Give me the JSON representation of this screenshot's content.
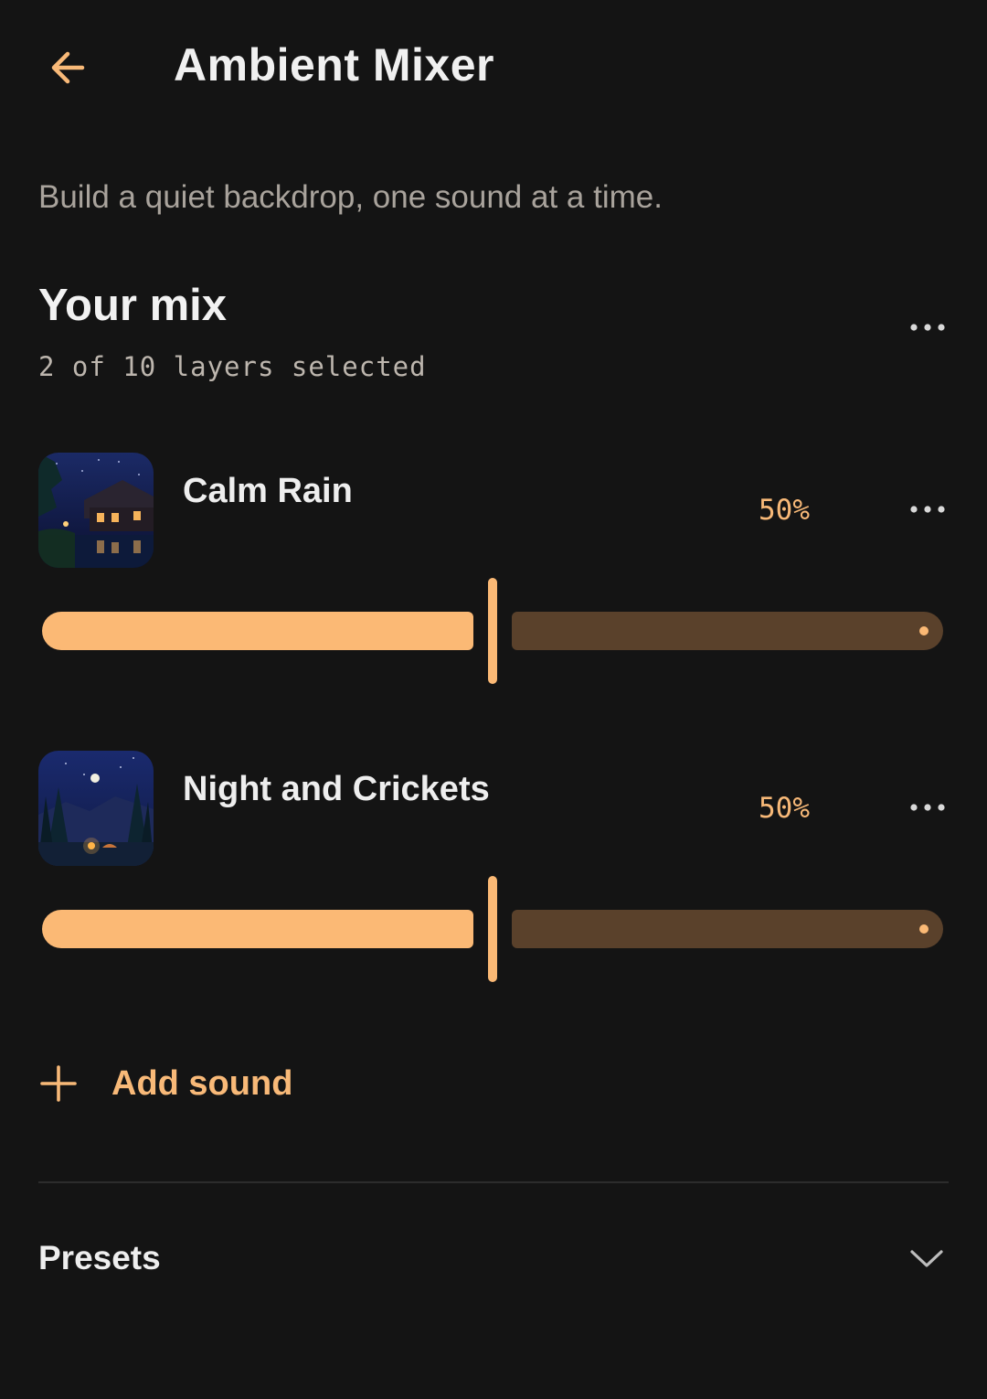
{
  "header": {
    "title": "Ambient Mixer",
    "back_icon": "arrow-left-icon"
  },
  "subtitle": "Build a quiet backdrop, one sound at a time.",
  "mix": {
    "title": "Your mix",
    "count_text": "2 of 10 layers selected",
    "menu_icon": "more-horizontal-icon",
    "layers": [
      {
        "name": "Calm Rain",
        "percent_text": "50%",
        "volume": 0.5,
        "thumb_icon": "rainy-cabin-night-image"
      },
      {
        "name": "Night and Crickets",
        "percent_text": "50%",
        "volume": 0.5,
        "thumb_icon": "forest-moon-campfire-image"
      }
    ]
  },
  "add_sound": {
    "label": "Add sound",
    "icon": "plus-icon"
  },
  "presets": {
    "label": "Presets",
    "icon": "chevron-down-icon"
  },
  "colors": {
    "accent": "#fbb975",
    "track_inactive": "#5a412b",
    "background": "#141414"
  }
}
